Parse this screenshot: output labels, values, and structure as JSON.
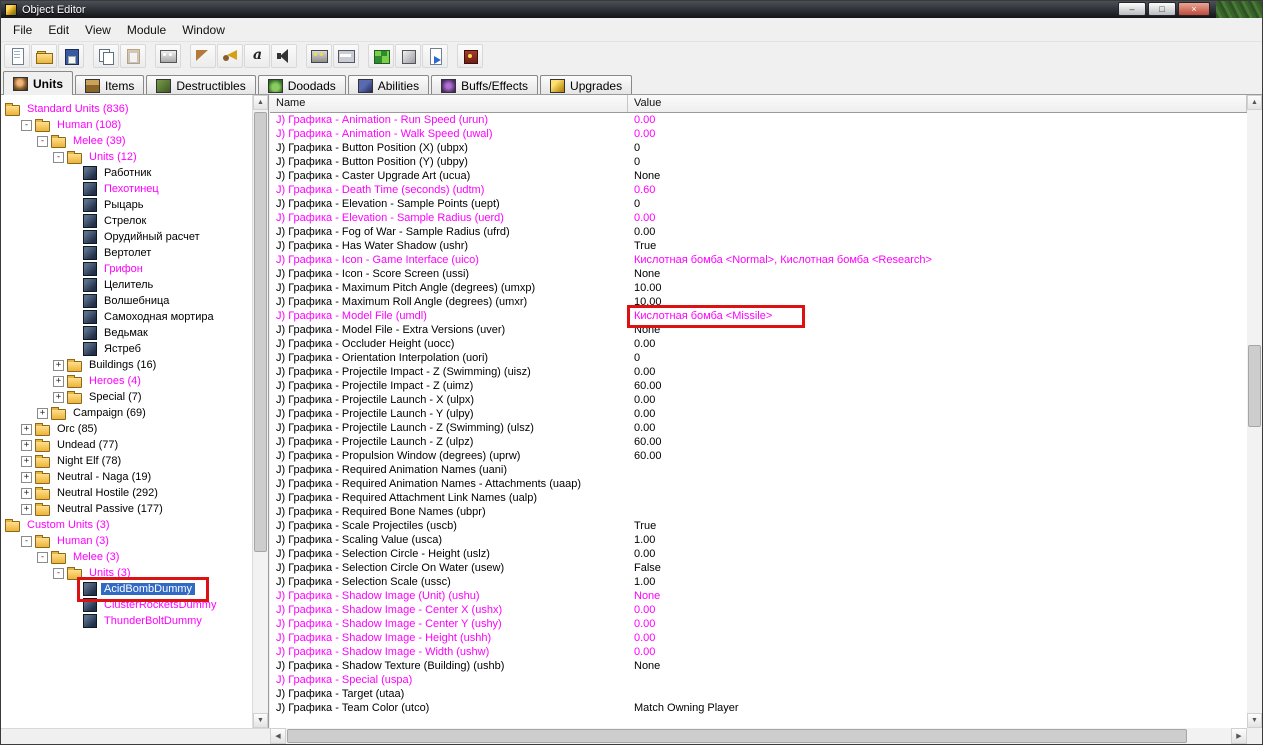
{
  "colors": {
    "modified": "#ff00ff",
    "selection": "#316ac5",
    "annotation": "#dd1111"
  },
  "window": {
    "title": "Object Editor",
    "controls": {
      "minimize": "–",
      "maximize": "□",
      "close": "×"
    }
  },
  "menu": {
    "items": [
      "File",
      "Edit",
      "View",
      "Module",
      "Window"
    ]
  },
  "toolbar": {
    "groups": [
      [
        {
          "name": "new-document"
        },
        {
          "name": "open"
        },
        {
          "name": "save"
        }
      ],
      [
        {
          "name": "copy"
        },
        {
          "name": "paste"
        }
      ],
      [
        {
          "name": "view-palette"
        }
      ],
      [
        {
          "name": "test-map"
        },
        {
          "name": "sound-horn"
        },
        {
          "name": "raw-data"
        },
        {
          "name": "preview-sound"
        }
      ],
      [
        {
          "name": "object-ids"
        },
        {
          "name": "model-card"
        }
      ],
      [
        {
          "name": "object-manager"
        },
        {
          "name": "import-manager"
        },
        {
          "name": "export-page"
        }
      ],
      [
        {
          "name": "campaign-editor"
        }
      ]
    ]
  },
  "tabs": [
    {
      "label": "Units",
      "active": true
    },
    {
      "label": "Items"
    },
    {
      "label": "Destructibles"
    },
    {
      "label": "Doodads"
    },
    {
      "label": "Abilities"
    },
    {
      "label": "Buffs/Effects"
    },
    {
      "label": "Upgrades"
    }
  ],
  "tree": {
    "items": [
      {
        "label": "Standard Units (836)",
        "level": 0,
        "kind": "root",
        "modified": true
      },
      {
        "label": "Human (108)",
        "level": 1,
        "kind": "folder",
        "expand": "minus",
        "modified": true
      },
      {
        "label": "Melee (39)",
        "level": 2,
        "kind": "folder",
        "expand": "minus",
        "modified": true
      },
      {
        "label": "Units (12)",
        "level": 3,
        "kind": "folder",
        "expand": "minus",
        "modified": true
      },
      {
        "label": "Работник",
        "level": 4,
        "kind": "unit"
      },
      {
        "label": "Пехотинец",
        "level": 4,
        "kind": "unit",
        "modified": true
      },
      {
        "label": "Рыцарь",
        "level": 4,
        "kind": "unit"
      },
      {
        "label": "Стрелок",
        "level": 4,
        "kind": "unit"
      },
      {
        "label": "Орудийный расчет",
        "level": 4,
        "kind": "unit"
      },
      {
        "label": "Вертолет",
        "level": 4,
        "kind": "unit"
      },
      {
        "label": "Грифон",
        "level": 4,
        "kind": "unit",
        "modified": true
      },
      {
        "label": "Целитель",
        "level": 4,
        "kind": "unit"
      },
      {
        "label": "Волшебница",
        "level": 4,
        "kind": "unit"
      },
      {
        "label": "Самоходная мортира",
        "level": 4,
        "kind": "unit"
      },
      {
        "label": "Ведьмак",
        "level": 4,
        "kind": "unit"
      },
      {
        "label": "Ястреб",
        "level": 4,
        "kind": "unit"
      },
      {
        "label": "Buildings (16)",
        "level": 3,
        "kind": "folder",
        "expand": "plus"
      },
      {
        "label": "Heroes (4)",
        "level": 3,
        "kind": "folder",
        "expand": "plus",
        "modified": true
      },
      {
        "label": "Special (7)",
        "level": 3,
        "kind": "folder",
        "expand": "plus"
      },
      {
        "label": "Campaign (69)",
        "level": 2,
        "kind": "folder",
        "expand": "plus"
      },
      {
        "label": "Orc (85)",
        "level": 1,
        "kind": "folder",
        "expand": "plus"
      },
      {
        "label": "Undead (77)",
        "level": 1,
        "kind": "folder",
        "expand": "plus"
      },
      {
        "label": "Night Elf (78)",
        "level": 1,
        "kind": "folder",
        "expand": "plus"
      },
      {
        "label": "Neutral - Naga (19)",
        "level": 1,
        "kind": "folder",
        "expand": "plus"
      },
      {
        "label": "Neutral Hostile (292)",
        "level": 1,
        "kind": "folder",
        "expand": "plus"
      },
      {
        "label": "Neutral Passive (177)",
        "level": 1,
        "kind": "folder",
        "expand": "plus"
      },
      {
        "label": "Custom Units (3)",
        "level": 0,
        "kind": "root",
        "modified": true
      },
      {
        "label": "Human (3)",
        "level": 1,
        "kind": "folder",
        "expand": "minus",
        "modified": true
      },
      {
        "label": "Melee (3)",
        "level": 2,
        "kind": "folder",
        "expand": "minus",
        "modified": true
      },
      {
        "label": "Units (3)",
        "level": 3,
        "kind": "folder",
        "expand": "minus",
        "modified": true
      },
      {
        "label": "AcidBombDummy",
        "level": 4,
        "kind": "unit",
        "selected": true
      },
      {
        "label": "ClusterRocketsDummy",
        "level": 4,
        "kind": "unit",
        "modified": true
      },
      {
        "label": "ThunderBoltDummy",
        "level": 4,
        "kind": "unit",
        "modified": true
      }
    ]
  },
  "grid": {
    "columns": [
      "Name",
      "Value"
    ],
    "rows": [
      {
        "name": "J) Графика - Animation - Run Speed (urun)",
        "value": "0.00",
        "modified": true
      },
      {
        "name": "J) Графика - Animation - Walk Speed (uwal)",
        "value": "0.00",
        "modified": true
      },
      {
        "name": "J) Графика - Button Position (X) (ubpx)",
        "value": "0"
      },
      {
        "name": "J) Графика - Button Position (Y) (ubpy)",
        "value": "0"
      },
      {
        "name": "J) Графика - Caster Upgrade Art (ucua)",
        "value": "None"
      },
      {
        "name": "J) Графика - Death Time (seconds) (udtm)",
        "value": "0.60",
        "modified": true
      },
      {
        "name": "J) Графика - Elevation - Sample Points (uept)",
        "value": "0"
      },
      {
        "name": "J) Графика - Elevation - Sample Radius (uerd)",
        "value": "0.00",
        "modified": true
      },
      {
        "name": "J) Графика - Fog of War - Sample Radius (ufrd)",
        "value": "0.00"
      },
      {
        "name": "J) Графика - Has Water Shadow (ushr)",
        "value": "True"
      },
      {
        "name": "J) Графика - Icon - Game Interface (uico)",
        "value": "Кислотная бомба <Normal>, Кислотная бомба <Research>",
        "modified": true
      },
      {
        "name": "J) Графика - Icon - Score Screen (ussi)",
        "value": "None"
      },
      {
        "name": "J) Графика - Maximum Pitch Angle (degrees) (umxp)",
        "value": "10.00"
      },
      {
        "name": "J) Графика - Maximum Roll Angle (degrees) (umxr)",
        "value": "10.00"
      },
      {
        "name": "J) Графика - Model File (umdl)",
        "value": "Кислотная бомба <Missile>",
        "modified": true
      },
      {
        "name": "J) Графика - Model File - Extra Versions (uver)",
        "value": "None"
      },
      {
        "name": "J) Графика - Occluder Height (uocc)",
        "value": "0.00"
      },
      {
        "name": "J) Графика - Orientation Interpolation (uori)",
        "value": "0"
      },
      {
        "name": "J) Графика - Projectile Impact - Z (Swimming) (uisz)",
        "value": "0.00"
      },
      {
        "name": "J) Графика - Projectile Impact - Z (uimz)",
        "value": "60.00"
      },
      {
        "name": "J) Графика - Projectile Launch - X (ulpx)",
        "value": "0.00"
      },
      {
        "name": "J) Графика - Projectile Launch - Y (ulpy)",
        "value": "0.00"
      },
      {
        "name": "J) Графика - Projectile Launch - Z (Swimming) (ulsz)",
        "value": "0.00"
      },
      {
        "name": "J) Графика - Projectile Launch - Z (ulpz)",
        "value": "60.00"
      },
      {
        "name": "J) Графика - Propulsion Window (degrees) (uprw)",
        "value": "60.00"
      },
      {
        "name": "J) Графика - Required Animation Names (uani)",
        "value": ""
      },
      {
        "name": "J) Графика - Required Animation Names - Attachments (uaap)",
        "value": ""
      },
      {
        "name": "J) Графика - Required Attachment Link Names (ualp)",
        "value": ""
      },
      {
        "name": "J) Графика - Required Bone Names (ubpr)",
        "value": ""
      },
      {
        "name": "J) Графика - Scale Projectiles (uscb)",
        "value": "True"
      },
      {
        "name": "J) Графика - Scaling Value (usca)",
        "value": "1.00"
      },
      {
        "name": "J) Графика - Selection Circle - Height (uslz)",
        "value": "0.00"
      },
      {
        "name": "J) Графика - Selection Circle On Water (usew)",
        "value": "False"
      },
      {
        "name": "J) Графика - Selection Scale (ussc)",
        "value": "1.00"
      },
      {
        "name": "J) Графика - Shadow Image (Unit) (ushu)",
        "value": "None",
        "modified": true
      },
      {
        "name": "J) Графика - Shadow Image - Center X (ushx)",
        "value": "0.00",
        "modified": true
      },
      {
        "name": "J) Графика - Shadow Image - Center Y (ushy)",
        "value": "0.00",
        "modified": true
      },
      {
        "name": "J) Графика - Shadow Image - Height (ushh)",
        "value": "0.00",
        "modified": true
      },
      {
        "name": "J) Графика - Shadow Image - Width (ushw)",
        "value": "0.00",
        "modified": true
      },
      {
        "name": "J) Графика - Shadow Texture (Building) (ushb)",
        "value": "None"
      },
      {
        "name": "J) Графика - Special (uspa)",
        "value": "",
        "modified": true
      },
      {
        "name": "J) Графика - Target (utaa)",
        "value": ""
      },
      {
        "name": "J) Графика - Team Color (utco)",
        "value": "Match Owning Player"
      }
    ]
  },
  "scrollbars": {
    "up": "▲",
    "down": "▼",
    "left": "◀",
    "right": "▶"
  }
}
